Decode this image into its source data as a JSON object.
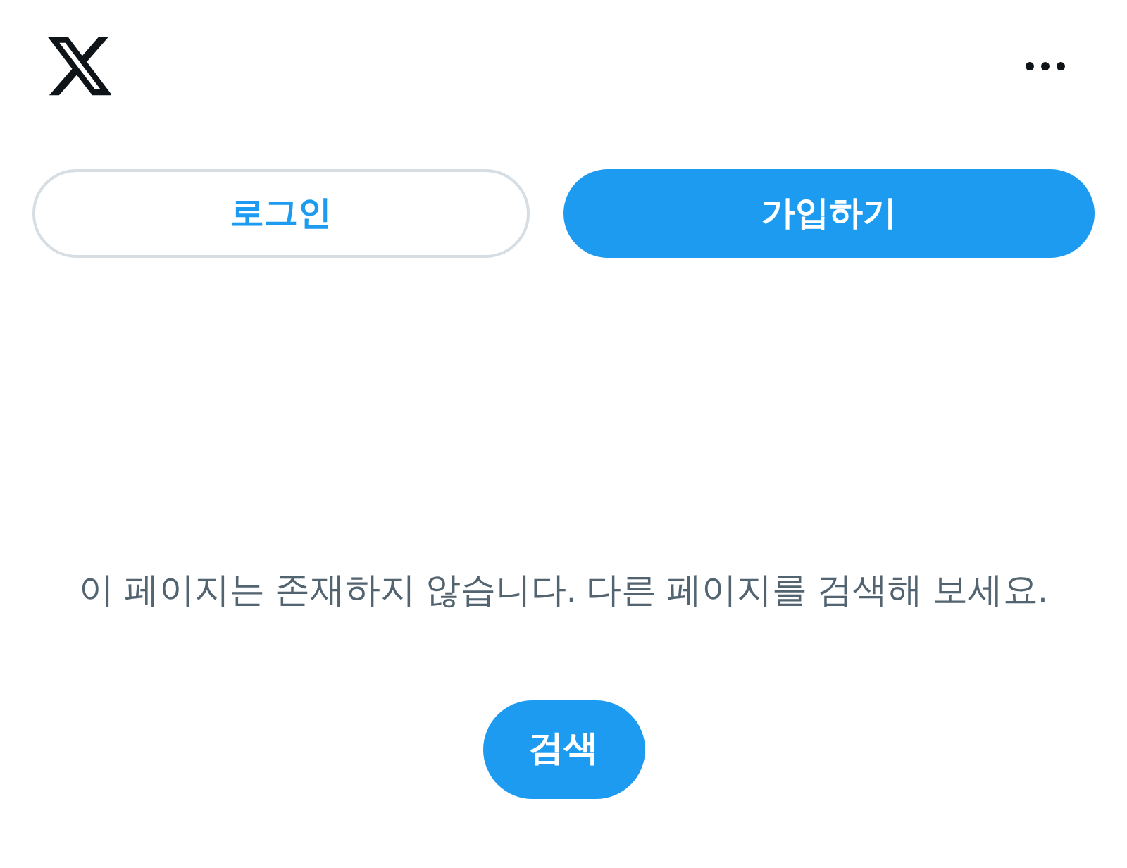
{
  "auth_buttons": [
    {
      "label": "로그인",
      "kind": "outline"
    },
    {
      "label": "가입하기",
      "kind": "filled"
    }
  ],
  "message": "이 페이지는 존재하지 않습니다. 다른 페이지를 검색해 보세요.",
  "search_button": {
    "label": "검색"
  }
}
